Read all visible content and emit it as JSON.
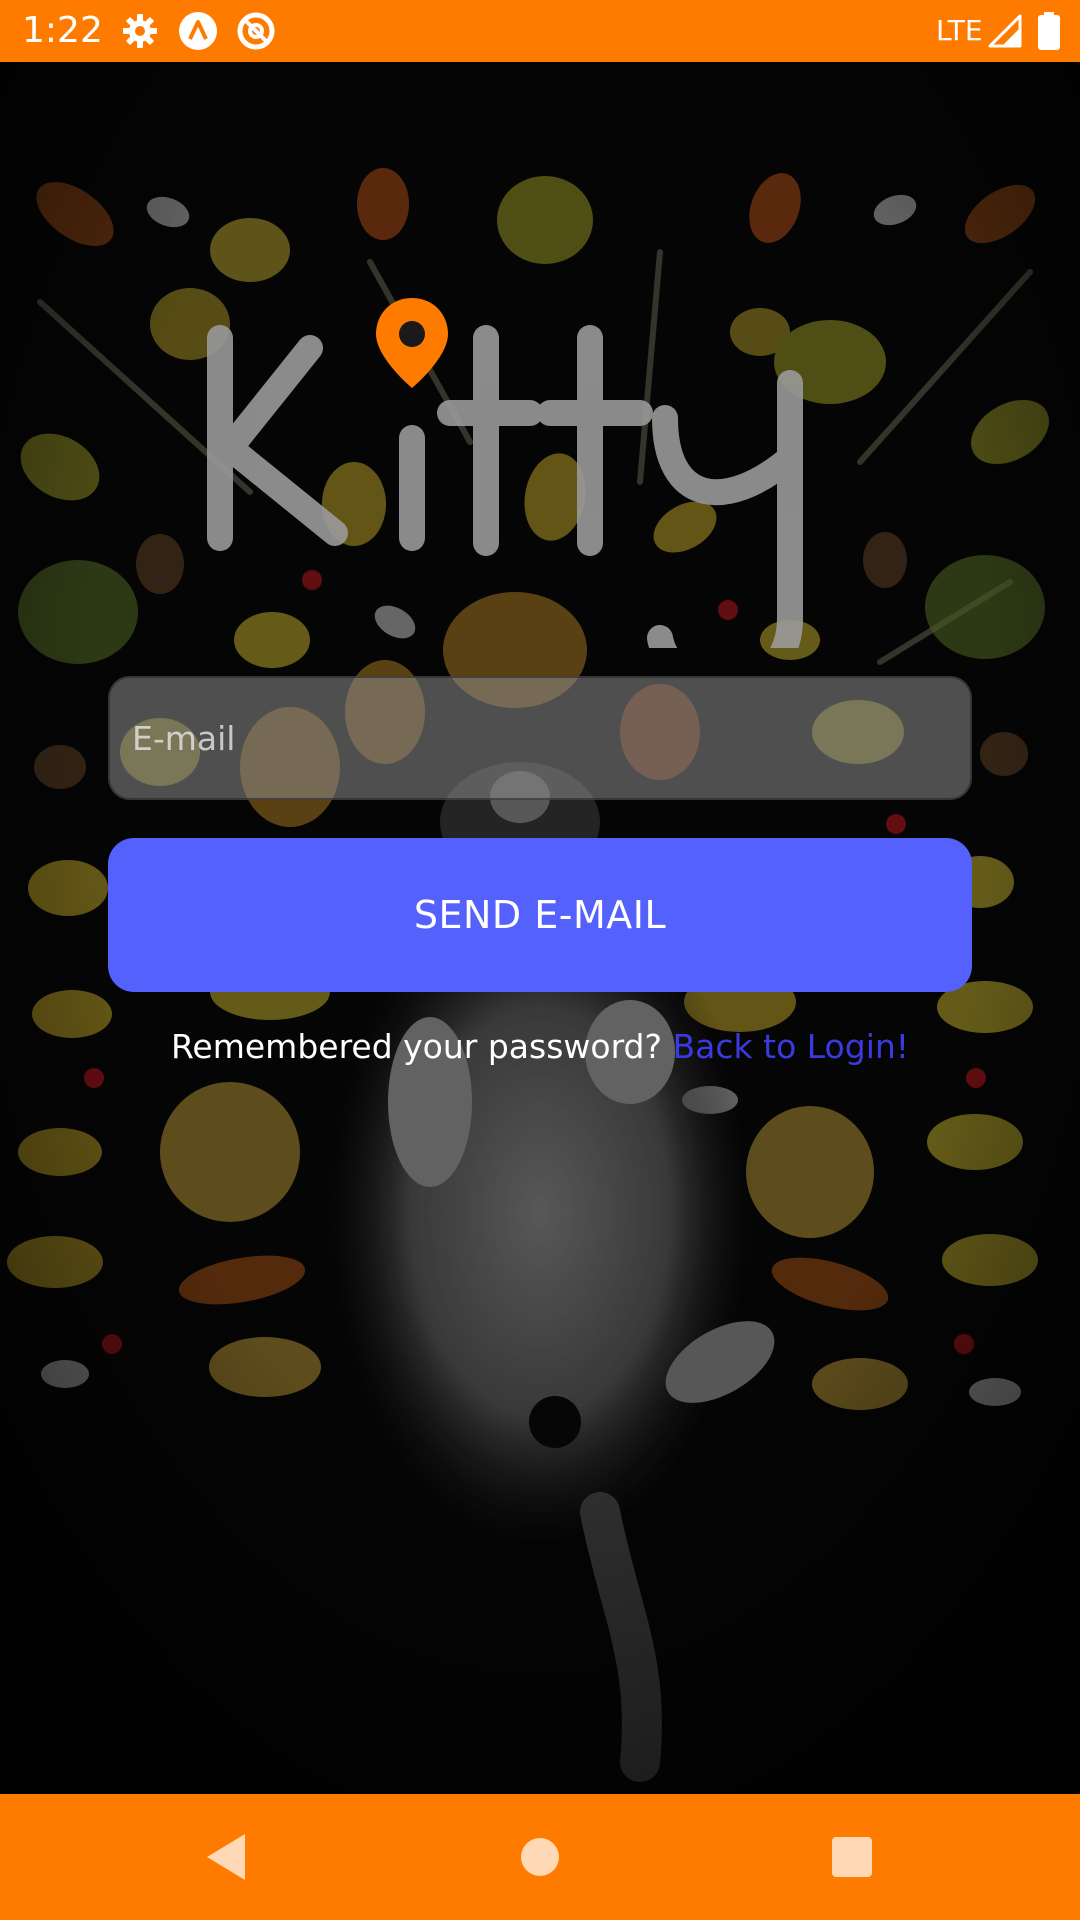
{
  "status_bar": {
    "time": "1:22",
    "network": "LTE",
    "icons": [
      "gear-icon",
      "app-a-icon",
      "no-disturb-icon",
      "signal-icon",
      "battery-icon"
    ]
  },
  "logo": {
    "text": "Kitty",
    "pin_color": "#ff7b00"
  },
  "form": {
    "email_placeholder": "E-mail",
    "email_value": "",
    "send_label": "SEND E-MAIL"
  },
  "footer": {
    "prompt": "Remembered your password?",
    "link_label": "Back to Login!"
  },
  "nav_bar": {
    "buttons": [
      "back-icon",
      "home-icon",
      "recents-icon"
    ]
  },
  "colors": {
    "status_bar": "#ff7b00",
    "button": "#5561fc",
    "link": "#3a3ae0"
  }
}
